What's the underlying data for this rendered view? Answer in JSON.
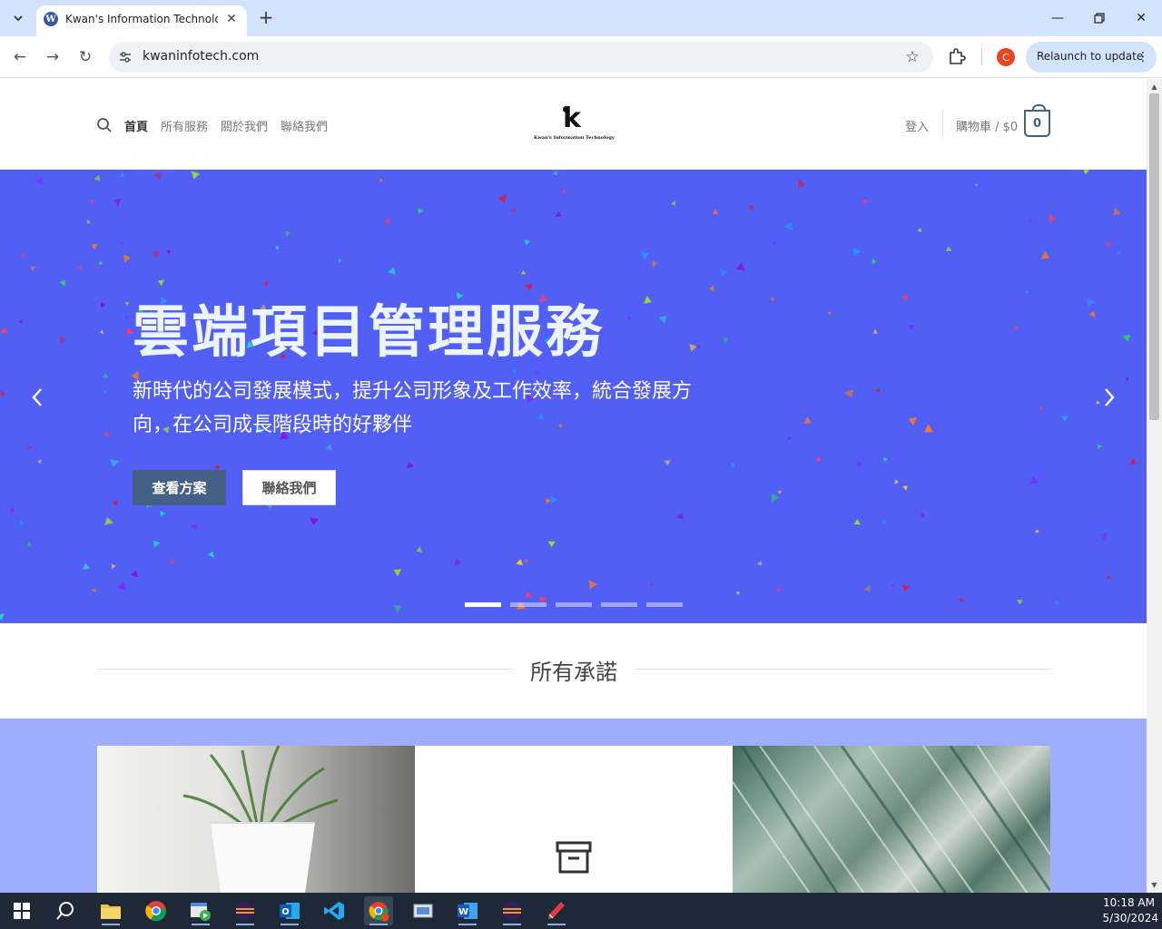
{
  "browser": {
    "tab_title": "Kwan's Information Technology",
    "tab_favicon": "W",
    "url": "kwaninfotech.com",
    "profile_initial": "C",
    "relaunch_label": "Relaunch to update"
  },
  "site": {
    "nav": [
      "首頁",
      "所有服務",
      "關於我們",
      "聯絡我們"
    ],
    "logo_letter": "k",
    "logo_text": "Kwan's Information Technology",
    "login": "登入",
    "cart_label": "購物車 / $0",
    "cart_count": "0"
  },
  "hero": {
    "title": "雲端項目管理服務",
    "subtitle": "新時代的公司發展模式，提升公司形象及工作效率，統合發展方向，在公司成長階段時的好夥伴",
    "primary_button": "查看方案",
    "secondary_button": "聯絡我們",
    "slide_count": 5,
    "active_slide": 1
  },
  "promises": {
    "title": "所有承諾"
  },
  "taskbar": {
    "time": "10:18 AM",
    "date": "5/30/2024"
  },
  "colors": {
    "hero_bg": "#525ff4",
    "button_primary": "#446084",
    "band_bg": "#9eaefc",
    "tab_strip": "#d3e3fd"
  }
}
